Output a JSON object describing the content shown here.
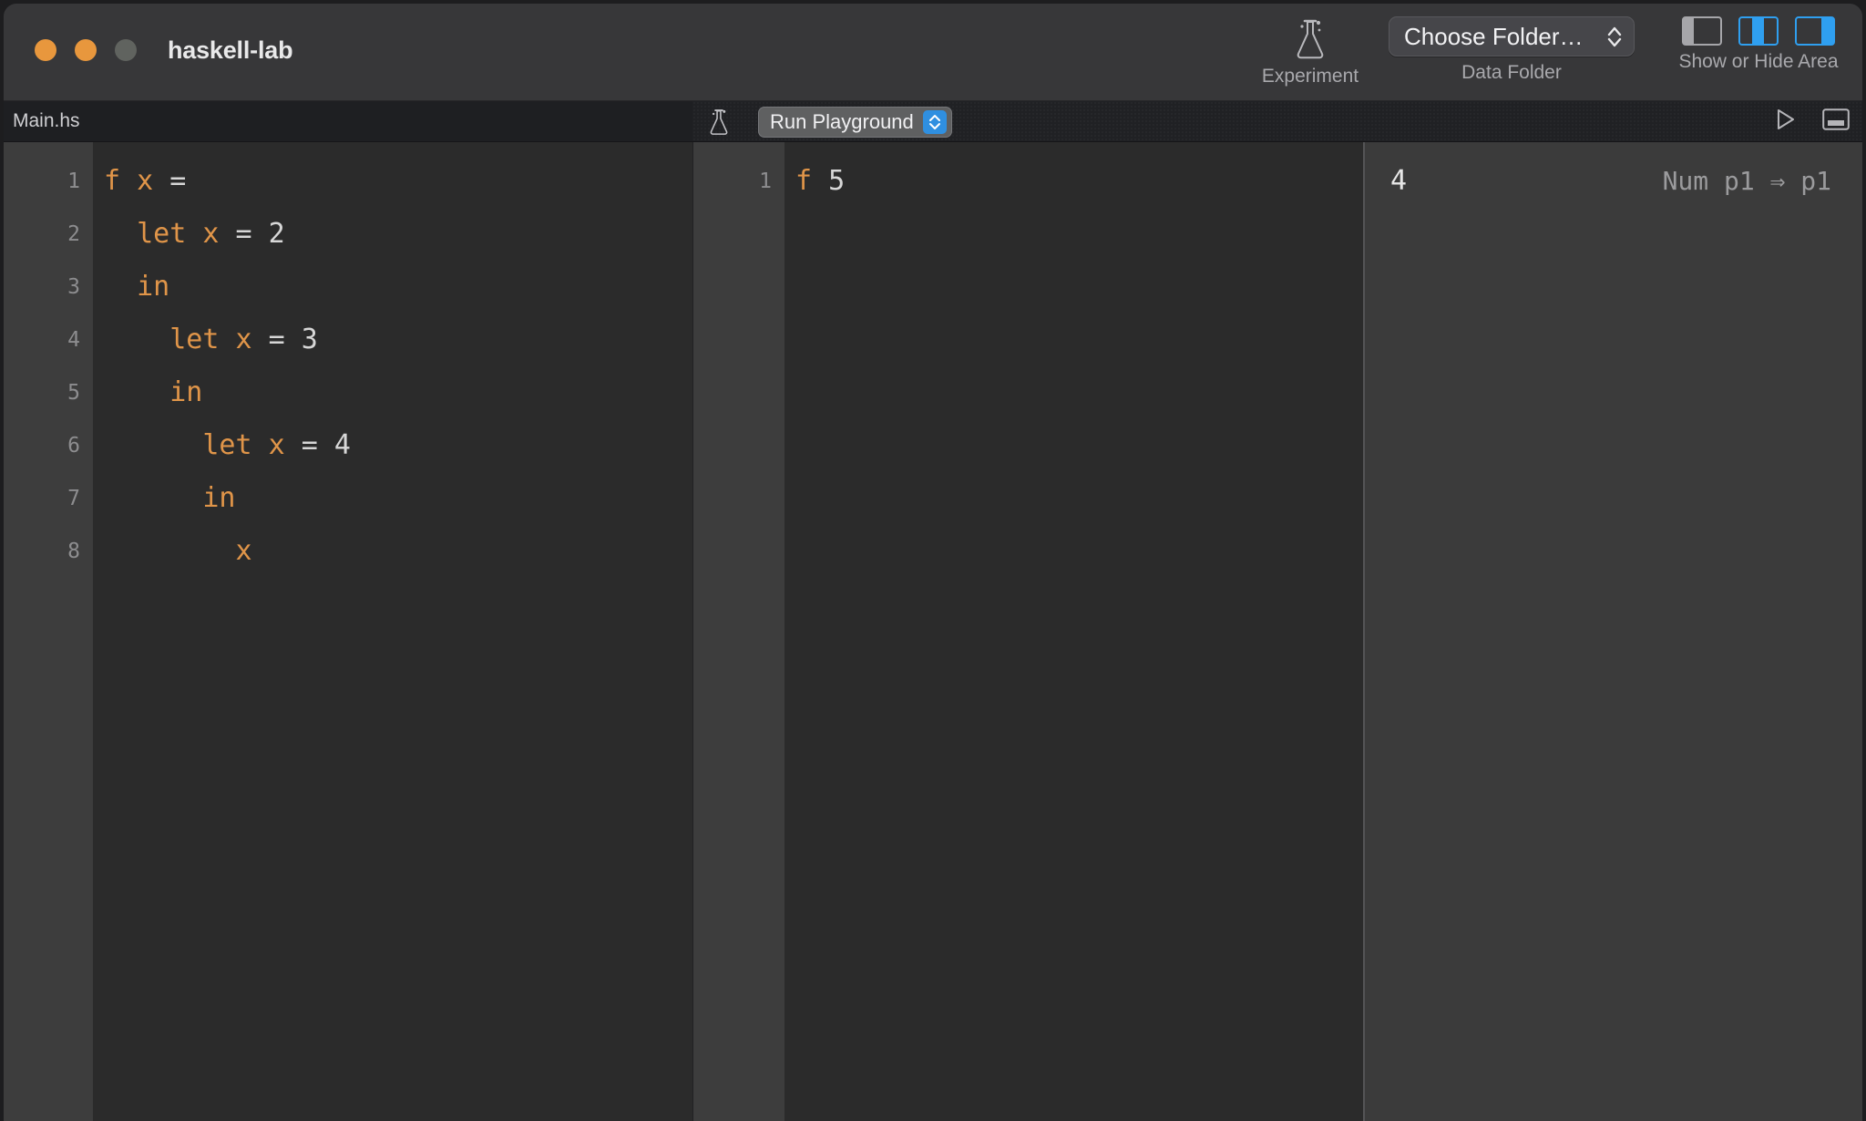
{
  "window": {
    "title": "haskell-lab",
    "traffic_lights": [
      {
        "name": "close",
        "color": "#e8973d"
      },
      {
        "name": "minimize",
        "color": "#e8973d"
      },
      {
        "name": "zoom",
        "color": "#60635f"
      }
    ]
  },
  "toolbar": {
    "experiment": {
      "caption": "Experiment",
      "icon": "flask-icon"
    },
    "data_folder": {
      "caption": "Data Folder",
      "button_label": "Choose Folder…",
      "icon": "chevron-updown-icon"
    },
    "show_hide_area": {
      "caption": "Show or Hide Area",
      "buttons": [
        {
          "name": "toggle-left-panel",
          "state": "inactive",
          "color": "#a6a6aa"
        },
        {
          "name": "toggle-center-panel",
          "state": "active",
          "color": "#2f9ff0"
        },
        {
          "name": "toggle-right-panel",
          "state": "active",
          "color": "#2f9ff0"
        }
      ]
    }
  },
  "tabbar": {
    "file_tab": "Main.hs",
    "flask_icon": "flask-icon",
    "run_popup_label": "Run Playground",
    "run_popup_accent": "#2f8fe0",
    "right_icons": [
      {
        "name": "run-play-icon"
      },
      {
        "name": "toggle-bottom-panel-icon"
      }
    ]
  },
  "editor": {
    "line_numbers": [
      "1",
      "2",
      "3",
      "4",
      "5",
      "6",
      "7",
      "8"
    ],
    "lines": [
      {
        "n": "1",
        "tokens": [
          {
            "t": "f",
            "k": "id"
          },
          {
            "t": " ",
            "k": "op"
          },
          {
            "t": "x",
            "k": "id"
          },
          {
            "t": " ",
            "k": "op"
          },
          {
            "t": "=",
            "k": "op"
          }
        ]
      },
      {
        "n": "2",
        "tokens": [
          {
            "t": "  ",
            "k": "op"
          },
          {
            "t": "let",
            "k": "kw"
          },
          {
            "t": " ",
            "k": "op"
          },
          {
            "t": "x",
            "k": "id"
          },
          {
            "t": " ",
            "k": "op"
          },
          {
            "t": "=",
            "k": "op"
          },
          {
            "t": " ",
            "k": "op"
          },
          {
            "t": "2",
            "k": "num"
          }
        ]
      },
      {
        "n": "3",
        "tokens": [
          {
            "t": "  ",
            "k": "op"
          },
          {
            "t": "in",
            "k": "kw"
          }
        ]
      },
      {
        "n": "4",
        "tokens": [
          {
            "t": "    ",
            "k": "op"
          },
          {
            "t": "let",
            "k": "kw"
          },
          {
            "t": " ",
            "k": "op"
          },
          {
            "t": "x",
            "k": "id"
          },
          {
            "t": " ",
            "k": "op"
          },
          {
            "t": "=",
            "k": "op"
          },
          {
            "t": " ",
            "k": "op"
          },
          {
            "t": "3",
            "k": "num"
          }
        ]
      },
      {
        "n": "5",
        "tokens": [
          {
            "t": "    ",
            "k": "op"
          },
          {
            "t": "in",
            "k": "kw"
          }
        ]
      },
      {
        "n": "6",
        "tokens": [
          {
            "t": "      ",
            "k": "op"
          },
          {
            "t": "let",
            "k": "kw"
          },
          {
            "t": " ",
            "k": "op"
          },
          {
            "t": "x",
            "k": "id"
          },
          {
            "t": " ",
            "k": "op"
          },
          {
            "t": "=",
            "k": "op"
          },
          {
            "t": " ",
            "k": "op"
          },
          {
            "t": "4",
            "k": "num"
          }
        ]
      },
      {
        "n": "7",
        "tokens": [
          {
            "t": "      ",
            "k": "op"
          },
          {
            "t": "in",
            "k": "kw"
          }
        ]
      },
      {
        "n": "8",
        "tokens": [
          {
            "t": "        ",
            "k": "op"
          },
          {
            "t": "x",
            "k": "id"
          }
        ]
      }
    ]
  },
  "playground": {
    "line_numbers": [
      "1"
    ],
    "lines": [
      {
        "n": "1",
        "tokens": [
          {
            "t": "f",
            "k": "id"
          },
          {
            "t": " ",
            "k": "op"
          },
          {
            "t": "5",
            "k": "num"
          }
        ]
      }
    ]
  },
  "results": {
    "rows": [
      {
        "value": "4",
        "type": "Num p1 ⇒ p1"
      }
    ]
  },
  "colors": {
    "accent_blue": "#2f9ff0",
    "keyword_orange": "#e09549",
    "editor_bg": "#2b2b2b",
    "gutter_bg": "#3d3d3d",
    "results_bg": "#3b3b3b",
    "titlebar_bg": "#373739",
    "tabbar_bg": "#202124"
  }
}
